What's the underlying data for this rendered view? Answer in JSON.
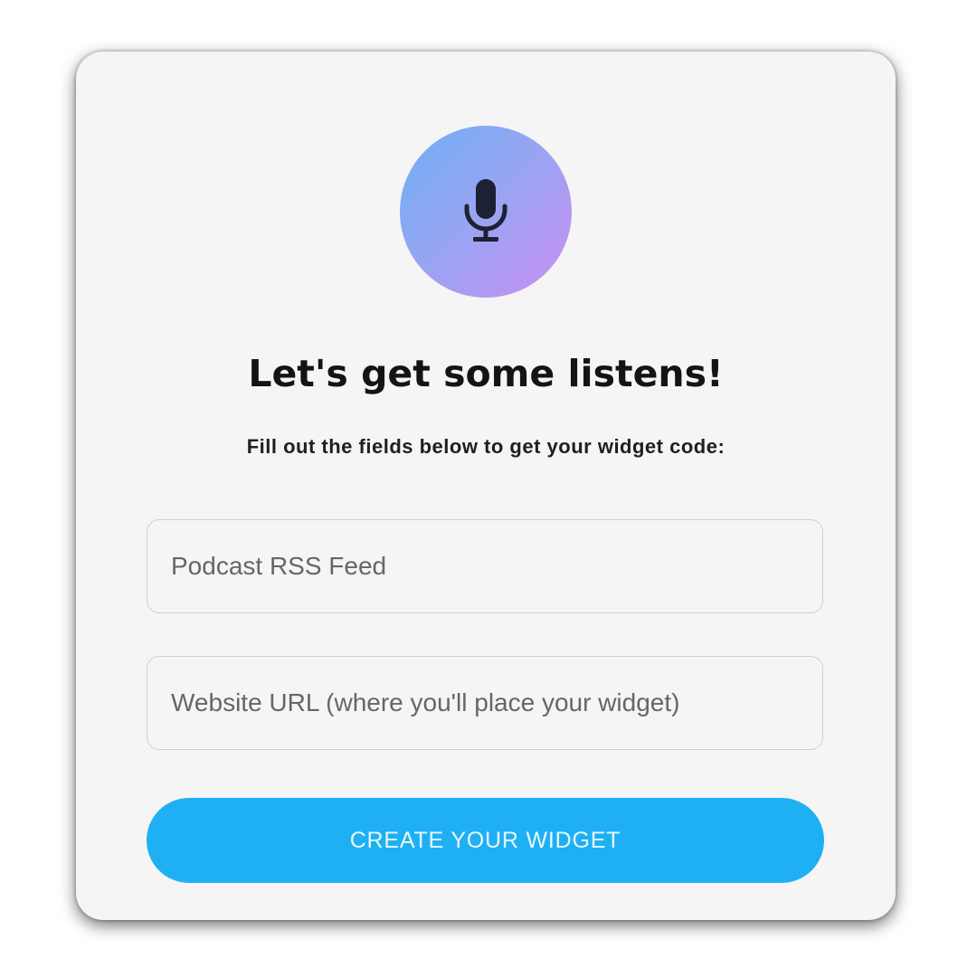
{
  "header": {
    "icon": "microphone-icon",
    "avatar_gradient": [
      "#6fb0f5",
      "#c98ef0"
    ],
    "title": "Let's get some listens!",
    "subtitle": "Fill out the fields below to get your widget code:"
  },
  "form": {
    "rss_placeholder": "Podcast RSS Feed",
    "rss_value": "",
    "website_placeholder": "Website URL (where you'll place your widget)",
    "website_value": "",
    "submit_label": "CREATE YOUR WIDGET"
  },
  "colors": {
    "accent": "#1fb0f4",
    "card_background": "#f5f5f5"
  }
}
